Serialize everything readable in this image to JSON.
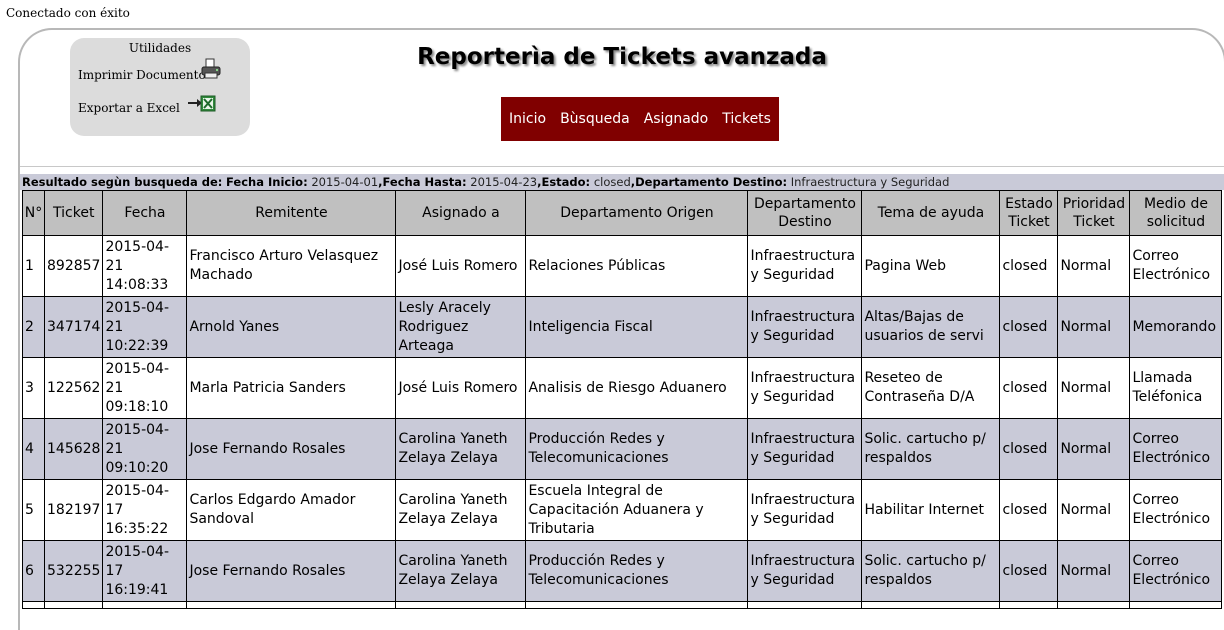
{
  "status_message": "Conectado con éxito",
  "utilities": {
    "title": "Utilidades",
    "print_label": "Imprimir Documento",
    "export_label": "Exportar a Excel"
  },
  "page_title": "Reporterìa de Tickets avanzada",
  "nav": {
    "items": [
      "Inicio",
      "Bùsqueda",
      "Asignado",
      "Tickets"
    ]
  },
  "criteria": {
    "prefix": "Resultado segùn busqueda de:",
    "fecha_inicio_label": "Fecha Inicio:",
    "fecha_inicio": "2015-04-01",
    "fecha_hasta_label": "Fecha Hasta:",
    "fecha_hasta": "2015-04-23",
    "estado_label": "Estado:",
    "estado": "closed",
    "depto_label": "Departamento Destino:",
    "depto": "Infraestructura y Seguridad"
  },
  "table": {
    "headers": [
      "N°",
      "Ticket",
      "Fecha",
      "Remitente",
      "Asignado a",
      "Departamento Origen",
      "Departamento Destino",
      "Tema de ayuda",
      "Estado Ticket",
      "Prioridad Ticket",
      "Medio de solicitud"
    ],
    "rows": [
      [
        "1",
        "892857",
        "2015-04-21 14:08:33",
        "Francisco Arturo Velasquez Machado",
        "José Luis Romero",
        "Relaciones Públicas",
        "Infraestructura y Seguridad",
        "Pagina Web",
        "closed",
        "Normal",
        "Correo Electrónico"
      ],
      [
        "2",
        "347174",
        "2015-04-21 10:22:39",
        "Arnold Yanes",
        "Lesly Aracely Rodriguez Arteaga",
        "Inteligencia Fiscal",
        "Infraestructura y Seguridad",
        "Altas/Bajas de usuarios de servi",
        "closed",
        "Normal",
        "Memorando"
      ],
      [
        "3",
        "122562",
        "2015-04-21 09:18:10",
        "Marla Patricia Sanders",
        "José Luis Romero",
        "Analisis de Riesgo Aduanero",
        "Infraestructura y Seguridad",
        "Reseteo de Contraseña D/A",
        "closed",
        "Normal",
        "Llamada Teléfonica"
      ],
      [
        "4",
        "145628",
        "2015-04-21 09:10:20",
        "Jose Fernando Rosales",
        "Carolina Yaneth Zelaya Zelaya",
        "Producción Redes y Telecomunicaciones",
        "Infraestructura y Seguridad",
        "Solic. cartucho p/ respaldos",
        "closed",
        "Normal",
        "Correo Electrónico"
      ],
      [
        "5",
        "182197",
        "2015-04-17 16:35:22",
        "Carlos Edgardo Amador Sandoval",
        "Carolina Yaneth Zelaya Zelaya",
        "Escuela Integral de Capacitación Aduanera y Tributaria",
        "Infraestructura y Seguridad",
        "Habilitar Internet",
        "closed",
        "Normal",
        "Correo Electrónico"
      ],
      [
        "6",
        "532255",
        "2015-04-17 16:19:41",
        "Jose Fernando Rosales",
        "Carolina Yaneth Zelaya Zelaya",
        "Producción Redes y Telecomunicaciones",
        "Infraestructura y Seguridad",
        "Solic. cartucho p/ respaldos",
        "closed",
        "Normal",
        "Correo Electrónico"
      ]
    ]
  }
}
